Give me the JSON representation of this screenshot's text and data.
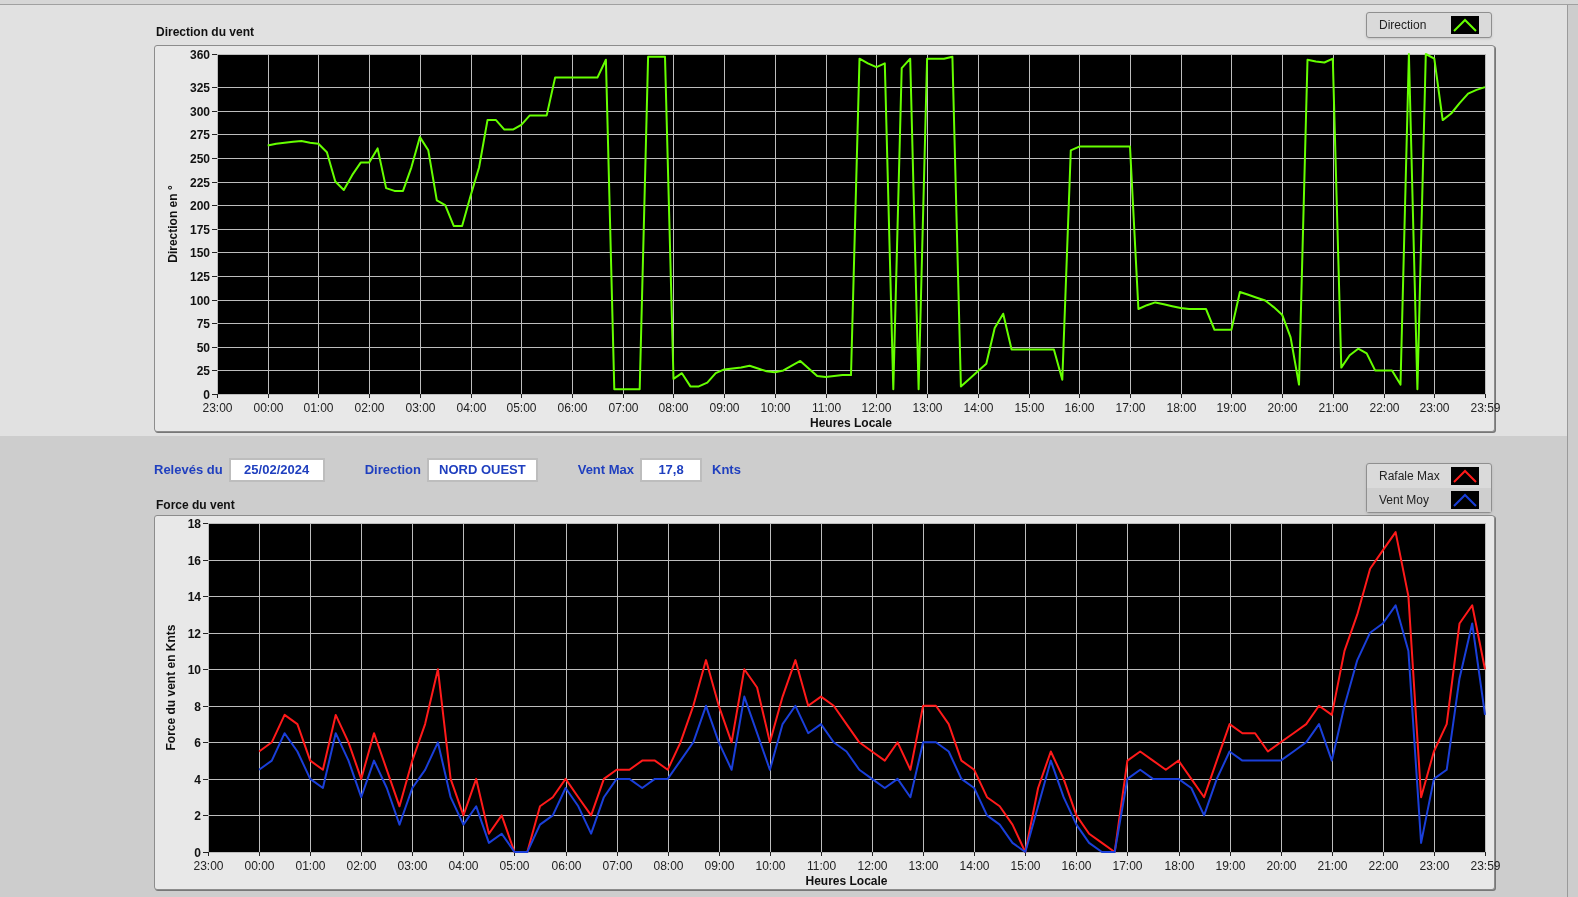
{
  "direction_chart": {
    "title": "Direction du vent",
    "chart_data": {
      "type": "line",
      "grid": true,
      "xlabel": "Heures Locale",
      "ylabel": "Direction en °",
      "ylim": [
        0,
        360
      ],
      "categories": [
        "23:00",
        null,
        null,
        null,
        null,
        null,
        "00:00",
        null,
        null,
        null,
        null,
        null,
        "01:00",
        null,
        null,
        null,
        null,
        null,
        "02:00",
        null,
        null,
        null,
        null,
        null,
        "03:00",
        null,
        null,
        null,
        null,
        null,
        "04:00",
        null,
        null,
        null,
        null,
        null,
        "05:00",
        null,
        null,
        null,
        null,
        null,
        "06:00",
        null,
        null,
        null,
        null,
        null,
        "07:00",
        null,
        null,
        null,
        null,
        null,
        "08:00",
        null,
        null,
        null,
        null,
        null,
        "09:00",
        null,
        null,
        null,
        null,
        null,
        "10:00",
        null,
        null,
        null,
        null,
        null,
        "11:00",
        null,
        null,
        null,
        null,
        null,
        "12:00",
        null,
        null,
        null,
        null,
        null,
        "13:00",
        null,
        null,
        null,
        null,
        null,
        "14:00",
        null,
        null,
        null,
        null,
        null,
        "15:00",
        null,
        null,
        null,
        null,
        null,
        "16:00",
        null,
        null,
        null,
        null,
        null,
        "17:00",
        null,
        null,
        null,
        null,
        null,
        "18:00",
        null,
        null,
        null,
        null,
        null,
        "19:00",
        null,
        null,
        null,
        null,
        null,
        "20:00",
        null,
        null,
        null,
        null,
        null,
        "21:00",
        null,
        null,
        null,
        null,
        null,
        "22:00",
        null,
        null,
        null,
        null,
        null,
        "23:00",
        null,
        null,
        null,
        null,
        null,
        "23:59"
      ],
      "yticks": [
        0,
        25,
        50,
        75,
        100,
        125,
        150,
        175,
        200,
        225,
        250,
        275,
        300,
        325,
        360
      ],
      "series": [
        {
          "name": "Direction",
          "color": "#66ff00",
          "values": [
            null,
            null,
            null,
            null,
            null,
            null,
            263,
            265,
            266,
            267,
            268,
            266,
            265,
            256,
            225,
            216,
            232,
            245,
            245,
            260,
            218,
            215,
            215,
            240,
            272,
            258,
            205,
            200,
            178,
            178,
            210,
            240,
            290,
            290,
            280,
            280,
            285,
            295,
            295,
            295,
            335,
            335,
            335,
            335,
            335,
            335,
            354,
            5,
            5,
            5,
            5,
            357,
            357,
            357,
            16,
            22,
            8,
            8,
            12,
            22,
            26,
            27,
            28,
            30,
            27,
            24,
            23,
            25,
            30,
            35,
            27,
            19,
            18,
            19,
            20,
            20,
            355,
            350,
            346,
            350,
            5,
            345,
            355,
            5,
            355,
            355,
            355,
            357,
            8,
            16,
            24,
            32,
            70,
            85,
            47,
            47,
            47,
            47,
            47,
            47,
            15,
            258,
            262,
            262,
            262,
            262,
            262,
            262,
            262,
            90,
            94,
            97,
            95,
            93,
            91,
            90,
            90,
            90,
            68,
            68,
            68,
            108,
            105,
            102,
            99,
            92,
            84,
            60,
            10,
            354,
            352,
            351,
            355,
            28,
            41,
            48,
            43,
            25,
            25,
            25,
            10,
            360,
            5,
            360,
            355,
            290,
            297,
            308,
            318,
            322,
            325
          ]
        }
      ]
    }
  },
  "readings": [
    {
      "label": "Relevés du",
      "value": "25/02/2024"
    },
    {
      "label": "Direction",
      "value": "NORD OUEST"
    },
    {
      "label": "Vent Max",
      "value": "17,8",
      "unit": "Knts"
    }
  ],
  "force_chart": {
    "title": "Force du vent",
    "chart_data": {
      "type": "line",
      "grid": true,
      "xlabel": "Heures Locale",
      "ylabel": "Force du vent en Knts",
      "ylim": [
        0,
        18
      ],
      "categories": [
        "23:00",
        null,
        null,
        null,
        "00:00",
        null,
        null,
        null,
        "01:00",
        null,
        null,
        null,
        "02:00",
        null,
        null,
        null,
        "03:00",
        null,
        null,
        null,
        "04:00",
        null,
        null,
        null,
        "05:00",
        null,
        null,
        null,
        "06:00",
        null,
        null,
        null,
        "07:00",
        null,
        null,
        null,
        "08:00",
        null,
        null,
        null,
        "09:00",
        null,
        null,
        null,
        "10:00",
        null,
        null,
        null,
        "11:00",
        null,
        null,
        null,
        "12:00",
        null,
        null,
        null,
        "13:00",
        null,
        null,
        null,
        "14:00",
        null,
        null,
        null,
        "15:00",
        null,
        null,
        null,
        "16:00",
        null,
        null,
        null,
        "17:00",
        null,
        null,
        null,
        "18:00",
        null,
        null,
        null,
        "19:00",
        null,
        null,
        null,
        "20:00",
        null,
        null,
        null,
        "21:00",
        null,
        null,
        null,
        "22:00",
        null,
        null,
        null,
        "23:00",
        null,
        null,
        null,
        "23:59"
      ],
      "yticks": [
        0,
        2,
        4,
        6,
        8,
        10,
        12,
        14,
        16,
        18
      ],
      "series": [
        {
          "name": "Rafale Max",
          "color": "#ff1a1a",
          "values": [
            null,
            null,
            null,
            null,
            5.5,
            6,
            7.5,
            7,
            5,
            4.5,
            7.5,
            6,
            4,
            6.5,
            4.5,
            2.5,
            5,
            7,
            10,
            4,
            2,
            4,
            1,
            2,
            0,
            0,
            2.5,
            3,
            4,
            3,
            2,
            4,
            4.5,
            4.5,
            5,
            5,
            4.5,
            6,
            8,
            10.5,
            8,
            6,
            10,
            9,
            6,
            8.5,
            10.5,
            8,
            8.5,
            8,
            7,
            6,
            5.5,
            5,
            6,
            4.5,
            8,
            8,
            7,
            5,
            4.5,
            3,
            2.5,
            1.5,
            0,
            3.5,
            5.5,
            4,
            2,
            1,
            0.5,
            0,
            5,
            5.5,
            5,
            4.5,
            5,
            4,
            3,
            5,
            7,
            6.5,
            6.5,
            5.5,
            6,
            6.5,
            7,
            8,
            7.5,
            11,
            13,
            15.5,
            16.5,
            17.5,
            14,
            3,
            5.5,
            7,
            12.5,
            13.5,
            10
          ]
        },
        {
          "name": "Vent Moy",
          "color": "#1a3fd9",
          "values": [
            null,
            null,
            null,
            null,
            4.5,
            5,
            6.5,
            5.5,
            4,
            3.5,
            6.5,
            5,
            3,
            5,
            3.5,
            1.5,
            3.5,
            4.5,
            6,
            3,
            1.5,
            2.5,
            0.5,
            1,
            0,
            0,
            1.5,
            2,
            3.5,
            2.5,
            1,
            3,
            4,
            4,
            3.5,
            4,
            4,
            5,
            6,
            8,
            6,
            4.5,
            8.5,
            6.5,
            4.5,
            7,
            8,
            6.5,
            7,
            6,
            5.5,
            4.5,
            4,
            3.5,
            4,
            3,
            6,
            6,
            5.5,
            4,
            3.5,
            2,
            1.5,
            0.5,
            0,
            2.5,
            5,
            3,
            1.5,
            0.5,
            0,
            0,
            4,
            4.5,
            4,
            4,
            4,
            3.5,
            2,
            4,
            5.5,
            5,
            5,
            5,
            5,
            5.5,
            6,
            7,
            5,
            8,
            10.5,
            12,
            12.5,
            13.5,
            11,
            0.5,
            4,
            4.5,
            9.5,
            12.5,
            7.5
          ]
        }
      ]
    }
  }
}
